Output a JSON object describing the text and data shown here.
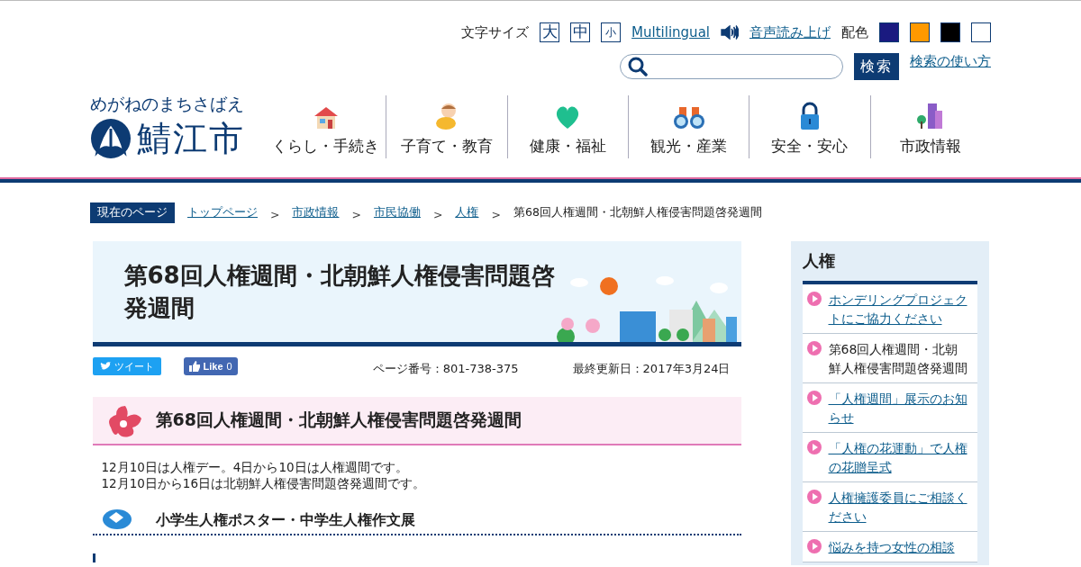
{
  "utility": {
    "font_size_label": "文字サイズ",
    "font_sizes": [
      {
        "label": "大"
      },
      {
        "label": "中"
      },
      {
        "label": "小"
      }
    ],
    "multilingual": "Multilingual",
    "speech": "音声読み上げ",
    "color_label": "配色",
    "color_swatches": [
      {
        "color": "#1a1a80"
      },
      {
        "color": "#ff9900"
      },
      {
        "color": "#000000"
      },
      {
        "color": "#ffffff"
      }
    ]
  },
  "search": {
    "button": "検索",
    "help": "検索の使い方"
  },
  "logo": {
    "tagline": "めがねのまちさばえ",
    "name": "鯖江市"
  },
  "nav": [
    {
      "label": "くらし・手続き"
    },
    {
      "label": "子育て・教育"
    },
    {
      "label": "健康・福祉"
    },
    {
      "label": "観光・産業"
    },
    {
      "label": "安全・安心"
    },
    {
      "label": "市政情報"
    }
  ],
  "breadcrumb": {
    "label": "現在のページ",
    "links": [
      "トップページ",
      "市政情報",
      "市民協働",
      "人権"
    ],
    "separators": [
      ">",
      ">",
      ">",
      ">"
    ],
    "current": "第68回人権週間・北朝鮮人権侵害問題啓発週間"
  },
  "page_title": "第68回人権週間・北朝鮮人権侵害問題啓発週間",
  "share": {
    "tweet": "ツイート",
    "like": "Like",
    "like_count": "0"
  },
  "page_number": "ページ番号：801-738-375",
  "updated": "最終更新日：2017年3月24日",
  "heading": "第68回人権週間・北朝鮮人権侵害問題啓発週間",
  "paragraphs": [
    "12月10日は人権デー。4日から10日は人権週間です。",
    "12月10日から16日は北朝鮮人権侵害問題啓発週間です。"
  ],
  "subheading": "小学生人権ポスター・中学生人権作文展",
  "sidebar": {
    "title": "人権",
    "items": [
      {
        "label": "ホンデリングプロジェクトにご協力ください",
        "selected": false
      },
      {
        "label": "第68回人権週間・北朝鮮人権侵害問題啓発週間",
        "selected": true
      },
      {
        "label": "「人権週間」展示のお知らせ",
        "selected": false
      },
      {
        "label": "「人権の花運動」で人権の花贈呈式",
        "selected": false
      },
      {
        "label": "人権擁護委員にご相談ください",
        "selected": false
      },
      {
        "label": "悩みを持つ女性の相談",
        "selected": false
      }
    ]
  }
}
